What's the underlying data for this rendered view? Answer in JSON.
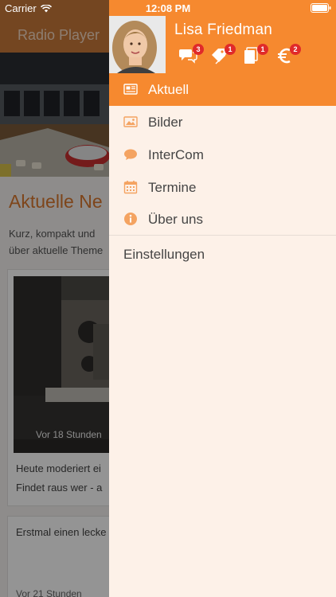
{
  "status_bar": {
    "carrier": "Carrier",
    "time": "12:08 PM"
  },
  "app": {
    "title": "Radio Player",
    "section_title": "Aktuelle Ne",
    "intro_line1": "Kurz, kompakt und",
    "intro_line2": "über aktuelle Theme",
    "card1": {
      "photo_caption": "Vor 18 Stunden",
      "text_line1": "Heute moderiert ei",
      "text_line2": "Findet raus wer - a"
    },
    "card2": {
      "text": "Erstmal einen lecke",
      "time": "Vor 21 Stunden"
    }
  },
  "drawer": {
    "user_name": "Lisa Friedman",
    "header_icons": [
      {
        "name": "chat-icon",
        "badge": "3"
      },
      {
        "name": "tag-icon",
        "badge": "1"
      },
      {
        "name": "documents-icon",
        "badge": "1"
      },
      {
        "name": "euro-icon",
        "badge": "2"
      }
    ],
    "menu": [
      {
        "label": "Aktuell",
        "icon": "news-icon",
        "active": true
      },
      {
        "label": "Bilder",
        "icon": "image-icon",
        "active": false
      },
      {
        "label": "InterCom",
        "icon": "chat-bubble-icon",
        "active": false
      },
      {
        "label": "Termine",
        "icon": "calendar-icon",
        "active": false
      },
      {
        "label": "Über uns",
        "icon": "info-icon",
        "active": false
      }
    ],
    "settings_label": "Einstellungen"
  },
  "colors": {
    "accent": "#f6892f",
    "drawer_bg": "#fdf1e8",
    "badge": "#e02a2a",
    "menu_icon": "#f4a361"
  }
}
